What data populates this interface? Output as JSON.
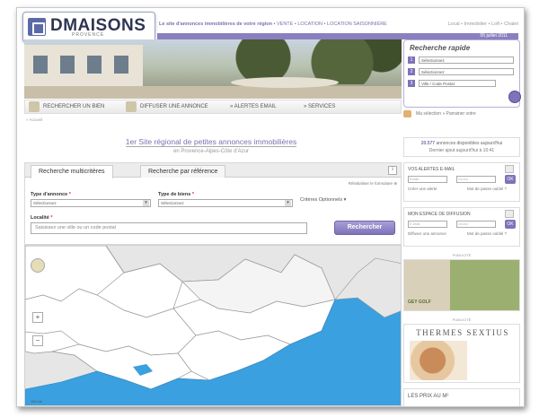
{
  "header": {
    "logo_main": "DMAISONS",
    "logo_sub": "PROVENCE",
    "tagline": "Le site d'annonces immobilières de votre région",
    "tagline_links": "• VENTE • LOCATION • LOCATION SAISONNIÈRE",
    "top_links": "Local • Immobilier • Loft • Chalet",
    "date": "05 juillet 2011"
  },
  "quick_search": {
    "title": "Recherche rapide",
    "rows": [
      {
        "num": "1",
        "value": "Sélectionnez"
      },
      {
        "num": "2",
        "value": "Sélectionnez"
      },
      {
        "num": "3",
        "value": "Ville / Code Postal"
      }
    ]
  },
  "nav": {
    "items": [
      "RECHERCHER UN BIEN",
      "DIFFUSER UNE ANNONCE",
      "» ALERTES EMAIL",
      "» SERVICES"
    ]
  },
  "breadcrumb": "» Accueil",
  "selection": {
    "label": "Ma sélection",
    "link": "» Parrainer votre"
  },
  "headline": {
    "title": "1er Site régional de petites annonces immobilières",
    "subtitle": "en Provence-Alpes-Côte d'Azur"
  },
  "counter": {
    "count": "20.577",
    "text": "annonces disponibles aujourd'hui",
    "updated": "Dernier ajout aujourd'hui à 10:41"
  },
  "search_card": {
    "tabs": [
      "Recherche multicritères",
      "Recherche par référence"
    ],
    "info": "i",
    "reset": "Réinitialiser le formulaire ⊕",
    "type_annonce_label": "Type d'annonce",
    "type_annonce_value": "Sélectionnez",
    "type_biens_label": "Type de biens",
    "type_biens_value": "Sélectionnez",
    "required_mark": "*",
    "criteres": "Critères Optionnels ▾",
    "localite_label": "Localité",
    "localite_placeholder": "Saisissez une ville ou un code postal",
    "search_button": "Rechercher"
  },
  "map": {
    "zoom_in": "+",
    "zoom_out": "−",
    "scale": "100 km",
    "colors": {
      "land": "#ffffff",
      "sea": "#3aa0e0",
      "other": "#e4e4e4",
      "border": "#999999"
    }
  },
  "alerts_box": {
    "title": "VOS ALERTES E-MAIL",
    "email_ph": "Email",
    "pass_ph": "••••••••",
    "ok": "OK",
    "create": "Créer une alerte",
    "forgot": "Mot de passe oublié ?"
  },
  "diffusion_box": {
    "title": "MON ESPACE DE DIFFUSION",
    "email_ph": "E-mail",
    "pass_ph": "••••••••",
    "ok": "OK",
    "create": "Diffuser une annonce",
    "forgot": "Mot de passe oublié ?"
  },
  "ads": {
    "label": "PUBLICITÉ",
    "golf_name": "GEY GOLF",
    "thermes_title": "THERMES SEXTIUS"
  },
  "prix": {
    "title": "LES PRIX AU M²"
  },
  "colors": {
    "accent": "#7e73b9",
    "brand": "#2e3552"
  }
}
